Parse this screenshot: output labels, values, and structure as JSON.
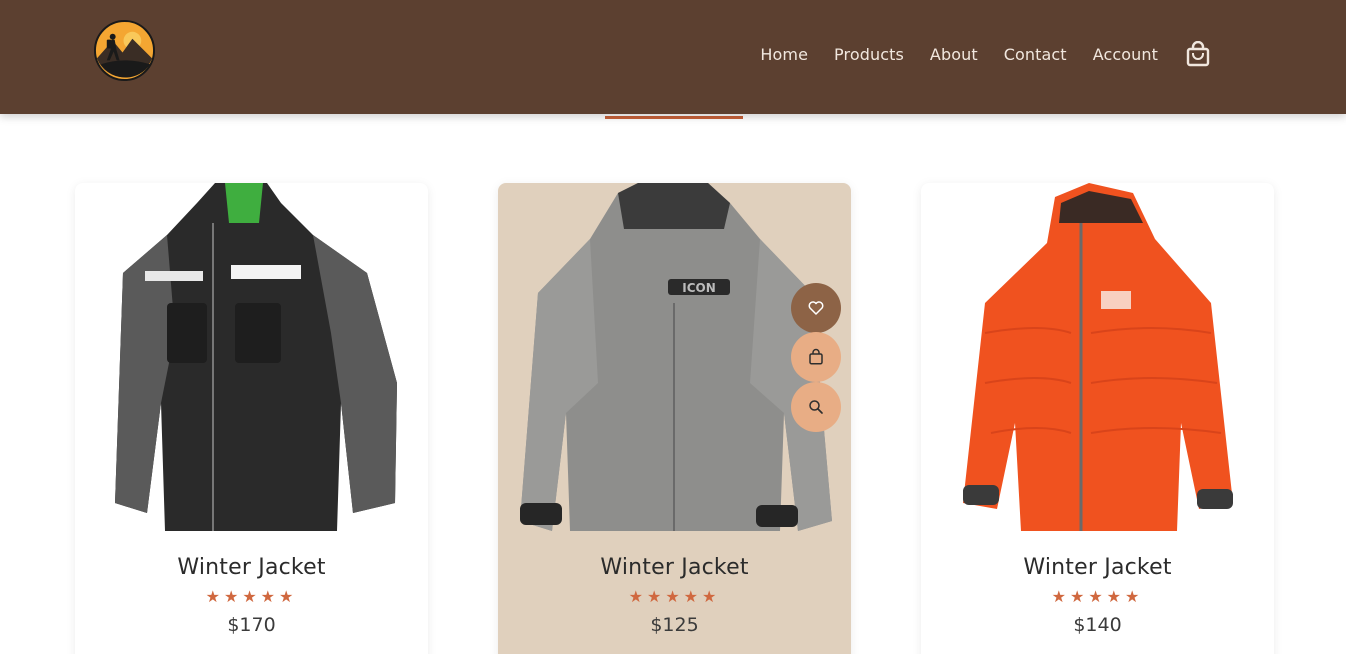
{
  "header": {
    "nav": [
      "Home",
      "Products",
      "About",
      "Contact",
      "Account"
    ]
  },
  "products": [
    {
      "name": "Winter Jacket",
      "rating": "★★★★★",
      "price": "$170",
      "image": "black-grey-motorcycle-jacket",
      "active": false
    },
    {
      "name": "Winter Jacket",
      "rating": "★★★★★",
      "price": "$125",
      "image": "grey-snow-jacket",
      "active": true
    },
    {
      "name": "Winter Jacket",
      "rating": "★★★★★",
      "price": "$140",
      "image": "orange-down-jacket",
      "active": false
    }
  ],
  "icons": [
    "logo-hiker-mountains",
    "shopping-bag-icon",
    "heart-icon",
    "bag-icon",
    "search-icon"
  ],
  "colors": {
    "header_bg": "#5c4030",
    "accent": "#c8623a",
    "active_card_bg": "#e0d0bd",
    "wish_btn": "#8d6346",
    "light_btn": "#e8ad85"
  }
}
